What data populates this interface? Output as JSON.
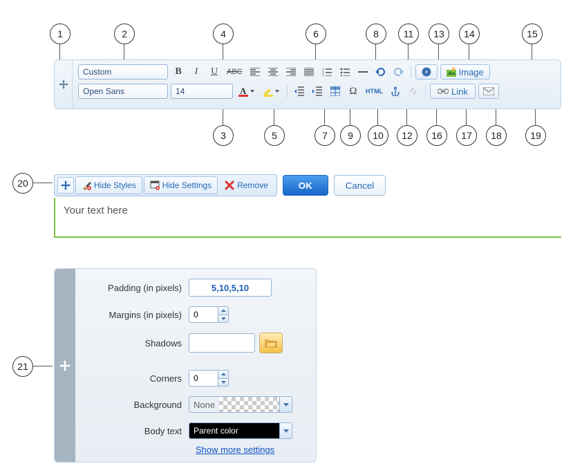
{
  "callouts": [
    "1",
    "2",
    "3",
    "4",
    "5",
    "6",
    "7",
    "8",
    "9",
    "10",
    "11",
    "12",
    "13",
    "14",
    "15",
    "16",
    "17",
    "18",
    "19",
    "20",
    "21"
  ],
  "toolbar": {
    "style_select": "Custom",
    "font_select": "Open Sans",
    "size_select": "14",
    "image_btn": "Image",
    "link_btn": "Link"
  },
  "mini": {
    "hide_styles": "Hide Styles",
    "hide_settings": "Hide Settings",
    "remove": "Remove",
    "ok": "OK",
    "cancel": "Cancel"
  },
  "text_placeholder": "Your text here",
  "settings": {
    "padding_label": "Padding (in pixels)",
    "padding_value": "5,10,5,10",
    "margins_label": "Margins (in pixels)",
    "margins_value": "0",
    "shadows_label": "Shadows",
    "shadows_value": "",
    "corners_label": "Corners",
    "corners_value": "0",
    "background_label": "Background",
    "background_value": "None",
    "bodytext_label": "Body text",
    "bodytext_value": "Parent color",
    "more": "Show more settings"
  }
}
